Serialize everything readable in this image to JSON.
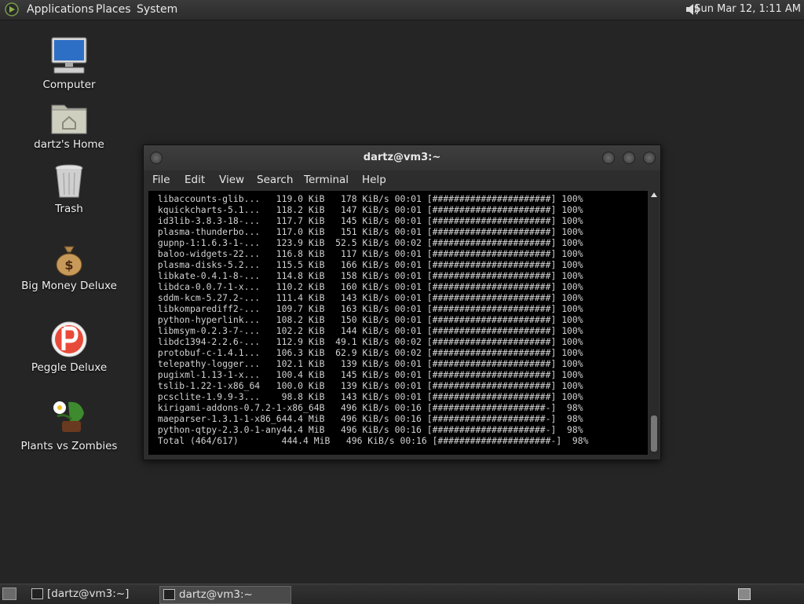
{
  "top_panel": {
    "menus": [
      "Applications",
      "Places",
      "System"
    ],
    "clock": "Sun Mar 12,  1:11 AM",
    "icons": [
      "distro-logo-icon",
      "volume-icon"
    ]
  },
  "desktop_icons": [
    {
      "label": "Computer",
      "icon": "computer-icon"
    },
    {
      "label": "dartz's Home",
      "icon": "home-folder-icon"
    },
    {
      "label": "Trash",
      "icon": "trash-icon"
    },
    {
      "label": "Big Money Deluxe",
      "icon": "money-bag-icon"
    },
    {
      "label": "Peggle Deluxe",
      "icon": "peggle-icon"
    },
    {
      "label": "Plants vs Zombies",
      "icon": "plants-icon"
    }
  ],
  "window": {
    "title": "dartz@vm3:~",
    "menu": [
      "File",
      "Edit",
      "View",
      "Search",
      "Terminal",
      "Help"
    ]
  },
  "terminal_lines": [
    " libaccounts-glib...   119.0 KiB   178 KiB/s 00:01 [######################] 100%",
    " kquickcharts-5.1...   118.2 KiB   147 KiB/s 00:01 [######################] 100%",
    " id3lib-3.8.3-18-...   117.7 KiB   145 KiB/s 00:01 [######################] 100%",
    " plasma-thunderbo...   117.0 KiB   151 KiB/s 00:01 [######################] 100%",
    " gupnp-1:1.6.3-1-...   123.9 KiB  52.5 KiB/s 00:02 [######################] 100%",
    " baloo-widgets-22...   116.8 KiB   117 KiB/s 00:01 [######################] 100%",
    " plasma-disks-5.2...   115.5 KiB   166 KiB/s 00:01 [######################] 100%",
    " libkate-0.4.1-8-...   114.8 KiB   158 KiB/s 00:01 [######################] 100%",
    " libdca-0.0.7-1-x...   110.2 KiB   160 KiB/s 00:01 [######################] 100%",
    " sddm-kcm-5.27.2-...   111.4 KiB   143 KiB/s 00:01 [######################] 100%",
    " libkomparediff2-...   109.7 KiB   163 KiB/s 00:01 [######################] 100%",
    " python-hyperlink...   108.2 KiB   150 KiB/s 00:01 [######################] 100%",
    " libmsym-0.2.3-7-...   102.2 KiB   144 KiB/s 00:01 [######################] 100%",
    " libdc1394-2.2.6-...   112.9 KiB  49.1 KiB/s 00:02 [######################] 100%",
    " protobuf-c-1.4.1...   106.3 KiB  62.9 KiB/s 00:02 [######################] 100%",
    " telepathy-logger...   102.1 KiB   139 KiB/s 00:01 [######################] 100%",
    " pugixml-1.13-1-x...   100.4 KiB   145 KiB/s 00:01 [######################] 100%",
    " tslib-1.22-1-x86_64   100.0 KiB   139 KiB/s 00:01 [######################] 100%",
    " pcsclite-1.9.9-3...    98.8 KiB   143 KiB/s 00:01 [######################] 100%",
    " kirigami-addons-0.7.2-1-x86_64B   496 KiB/s 00:16 [#####################-]  98%",
    " maeparser-1.3.1-1-x86_644.4 MiB   496 KiB/s 00:16 [#####################-]  98%",
    " python-qtpy-2.3.0-1-any44.4 MiB   496 KiB/s 00:16 [#####################-]  98%",
    " Total (464/617)        444.4 MiB   496 KiB/s 00:16 [#####################-]  98%"
  ],
  "taskbar": {
    "tasks": [
      "[dartz@vm3:~]",
      "dartz@vm3:~"
    ],
    "active_index": 1
  }
}
